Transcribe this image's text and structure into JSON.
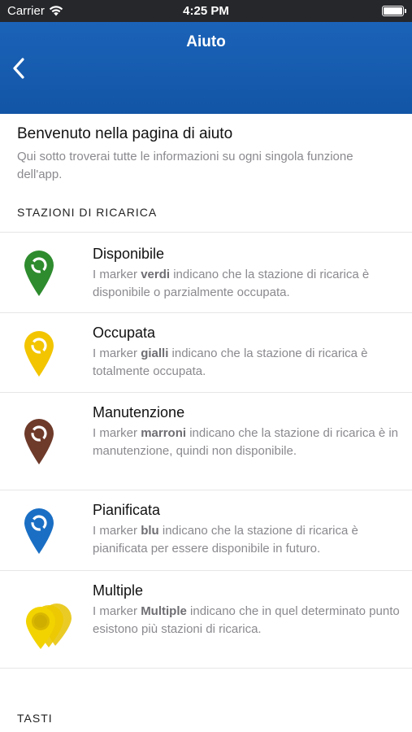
{
  "status_bar": {
    "carrier": "Carrier",
    "time": "4:25 PM"
  },
  "nav": {
    "title": "Aiuto"
  },
  "intro": {
    "heading": "Benvenuto nella pagina di aiuto",
    "subtitle": "Qui sotto troverai tutte le informazioni su ogni singola funzione dell'app."
  },
  "sections": {
    "stations": "STAZIONI DI RICARICA",
    "buttons": "TASTI"
  },
  "markers": [
    {
      "label": "Disponibile",
      "color": "#2e8b2e",
      "desc_prefix": "I marker ",
      "desc_bold": "verdi",
      "desc_suffix": " indicano che la stazione di ricarica è disponibile o parzialmente occupata."
    },
    {
      "label": "Occupata",
      "color": "#f2c500",
      "desc_prefix": "I marker ",
      "desc_bold": "gialli",
      "desc_suffix": " indicano che la stazione di ricarica è totalmente occupata."
    },
    {
      "label": "Manutenzione",
      "color": "#6e3a2a",
      "desc_prefix": "I marker ",
      "desc_bold": "marroni",
      "desc_suffix": " indicano che la stazione di ricarica è in manutenzione, quindi non disponibile."
    },
    {
      "label": "Pianificata",
      "color": "#1a6fc4",
      "desc_prefix": "I marker ",
      "desc_bold": "blu",
      "desc_suffix": " indicano che la stazione di ricarica è pianificata per essere disponibile in futuro."
    },
    {
      "label": "Multiple",
      "color": "#f2d300",
      "desc_prefix": "I marker ",
      "desc_bold": "Multiple",
      "desc_suffix": " indicano che in quel determinato punto esistono più stazioni di ricarica."
    }
  ],
  "icons": {
    "back": "chevron-left-icon",
    "wifi": "wifi-icon",
    "battery": "battery-icon"
  }
}
